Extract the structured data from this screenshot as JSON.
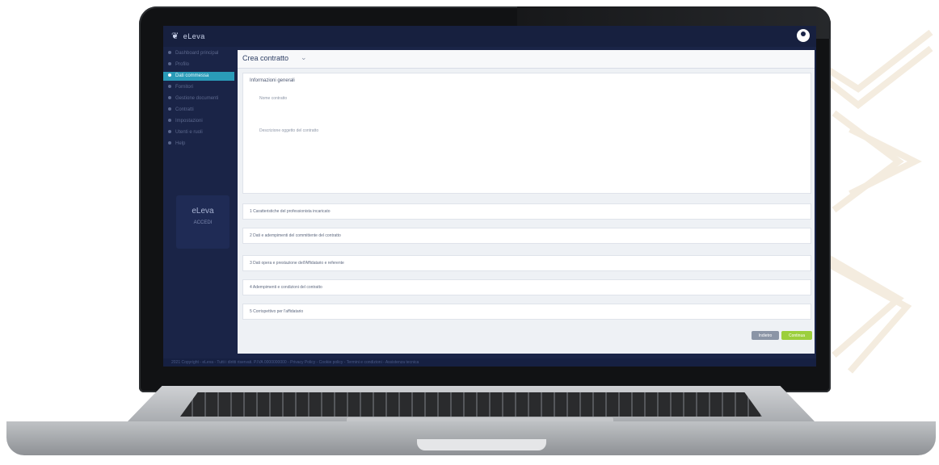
{
  "app": {
    "logo_text": "eLeva",
    "logo_mark": "❦"
  },
  "sidebar": {
    "items": [
      {
        "label": "Dashboard principal"
      },
      {
        "label": "Profilo"
      },
      {
        "label": "Dati commessa"
      },
      {
        "label": "Fornitori"
      },
      {
        "label": "Gestione documenti"
      },
      {
        "label": "Contratti"
      },
      {
        "label": "Impostazioni"
      },
      {
        "label": "Utenti e ruoli"
      },
      {
        "label": "Help"
      }
    ],
    "active_index": 2,
    "brand": {
      "name": "eLeva",
      "tag": "ACCEDI"
    }
  },
  "main": {
    "breadcrumb": "Crea contratto",
    "card_title": "Informazioni generali",
    "field_name": "Nome contratto",
    "field_desc": "Descrizione oggetto del contratto",
    "rows": [
      {
        "label": "1 Caratteristiche del professionista incaricato"
      },
      {
        "label": "2 Dati e adempimenti del committente del contratto"
      },
      {
        "label": "3 Dati opera e prestazione dell'Affidatario e referente"
      },
      {
        "label": "4 Adempimenti e condizioni del contratto"
      },
      {
        "label": "5 Corrispettivo per l'affidatario"
      }
    ],
    "buttons": {
      "secondary": "Indietro",
      "primary": "Continua"
    }
  },
  "status": {
    "text": "2021 Copyright - eLeva - Tutti i diritti riservati. P.IVA 0000000000 - Privacy Policy - Cookie policy - Termini e condizioni - Assistenza tecnica"
  },
  "colors": {
    "sidebar_bg": "#1a2447",
    "active": "#2a9bb8",
    "primary_button": "#9ccf3c"
  }
}
